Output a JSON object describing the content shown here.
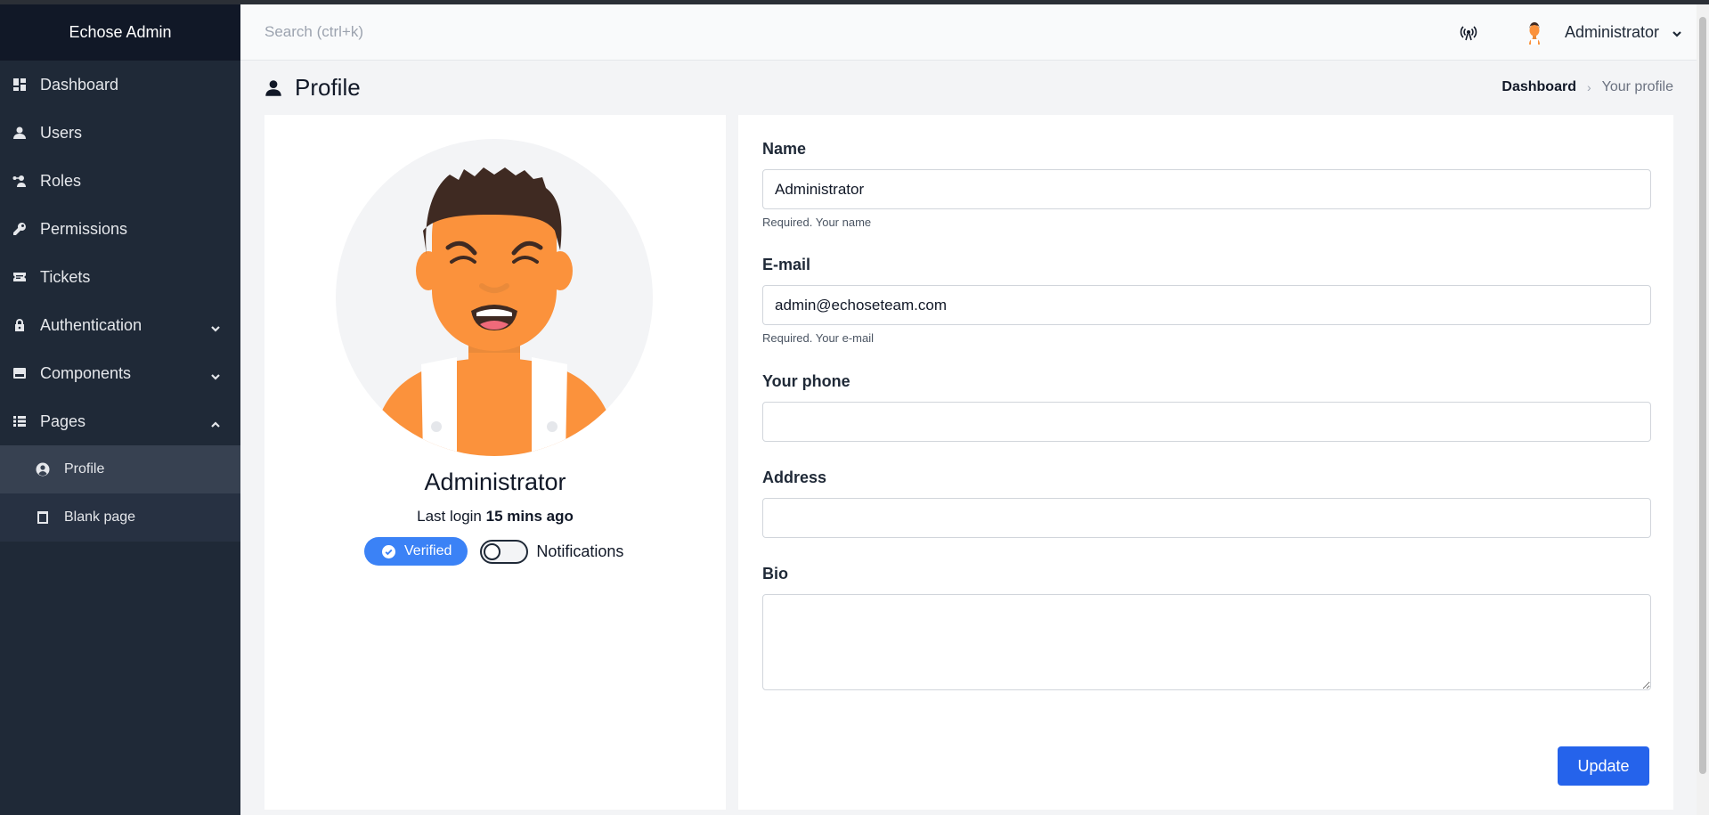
{
  "app": {
    "brand": "Echose Admin"
  },
  "sidebar": {
    "items": [
      {
        "label": "Dashboard"
      },
      {
        "label": "Users"
      },
      {
        "label": "Roles"
      },
      {
        "label": "Permissions"
      },
      {
        "label": "Tickets"
      },
      {
        "label": "Authentication"
      },
      {
        "label": "Components"
      },
      {
        "label": "Pages"
      }
    ],
    "sub_items": [
      {
        "label": "Profile",
        "active": true
      },
      {
        "label": "Blank page"
      }
    ]
  },
  "header": {
    "search_placeholder": "Search (ctrl+k)",
    "user_name": "Administrator"
  },
  "page": {
    "title": "Profile",
    "breadcrumb": {
      "home": "Dashboard",
      "current": "Your profile"
    }
  },
  "profile": {
    "name": "Administrator",
    "last_login_prefix": "Last login",
    "last_login_value": "15 mins ago",
    "verified_label": "Verified",
    "notifications_label": "Notifications",
    "notifications_on": false
  },
  "form": {
    "name": {
      "label": "Name",
      "value": "Administrator",
      "help": "Required. Your name"
    },
    "email": {
      "label": "E-mail",
      "value": "admin@echoseteam.com",
      "help": "Required. Your e-mail"
    },
    "phone": {
      "label": "Your phone",
      "value": ""
    },
    "address": {
      "label": "Address",
      "value": ""
    },
    "bio": {
      "label": "Bio",
      "value": ""
    },
    "submit_label": "Update"
  },
  "colors": {
    "sidebar_bg": "#1f2937",
    "brand_bg": "#111827",
    "accent": "#2563eb",
    "badge": "#3b82f6",
    "avatar_skin": "#fb923c"
  }
}
